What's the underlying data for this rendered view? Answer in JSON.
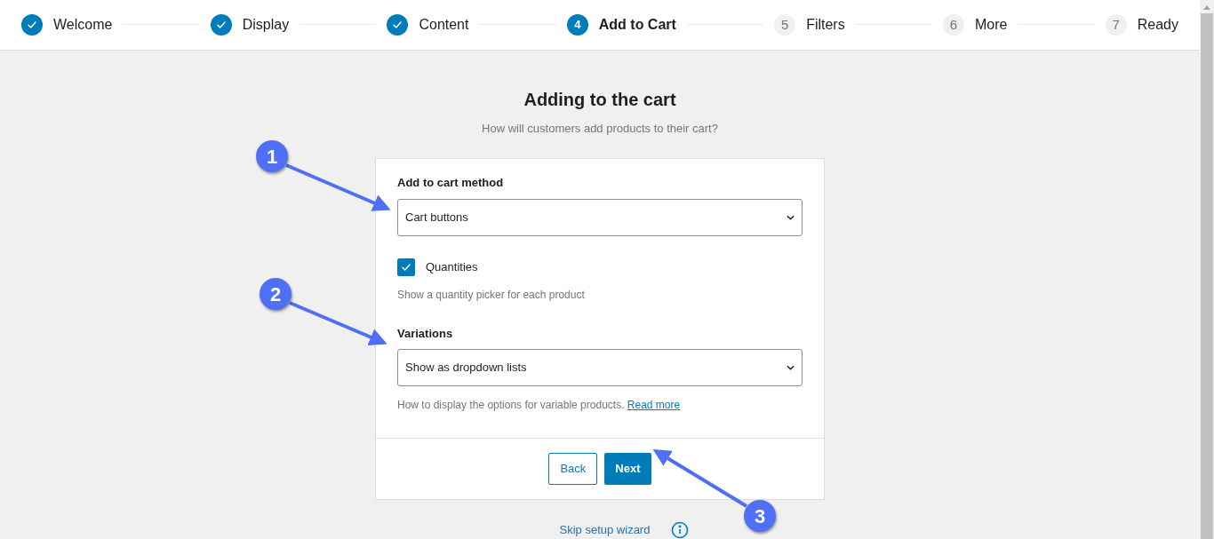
{
  "steps": [
    {
      "label": "Welcome",
      "completed": true,
      "selected": false
    },
    {
      "label": "Display",
      "completed": true,
      "selected": false
    },
    {
      "label": "Content",
      "completed": true,
      "selected": false
    },
    {
      "number": "4",
      "label": "Add to Cart",
      "completed": false,
      "selected": true
    },
    {
      "number": "5",
      "label": "Filters",
      "completed": false,
      "selected": false
    },
    {
      "number": "6",
      "label": "More",
      "completed": false,
      "selected": false
    },
    {
      "number": "7",
      "label": "Ready",
      "completed": false,
      "selected": false
    }
  ],
  "heading": "Adding to the cart",
  "subheading": "How will customers add products to their cart?",
  "form": {
    "cart_method": {
      "label": "Add to cart method",
      "value": "Cart buttons"
    },
    "quantities": {
      "label": "Quantities",
      "checked": true,
      "help": "Show a quantity picker for each product"
    },
    "variations": {
      "label": "Variations",
      "value": "Show as dropdown lists",
      "help": "How to display the options for variable products.",
      "help_link": "Read more"
    }
  },
  "buttons": [
    {
      "label": "Back",
      "kind": "secondary"
    },
    {
      "label": "Next",
      "kind": "primary"
    }
  ],
  "skip_link": "Skip setup wizard",
  "callouts": [
    {
      "label": "1"
    },
    {
      "label": "2"
    },
    {
      "label": "3"
    }
  ]
}
